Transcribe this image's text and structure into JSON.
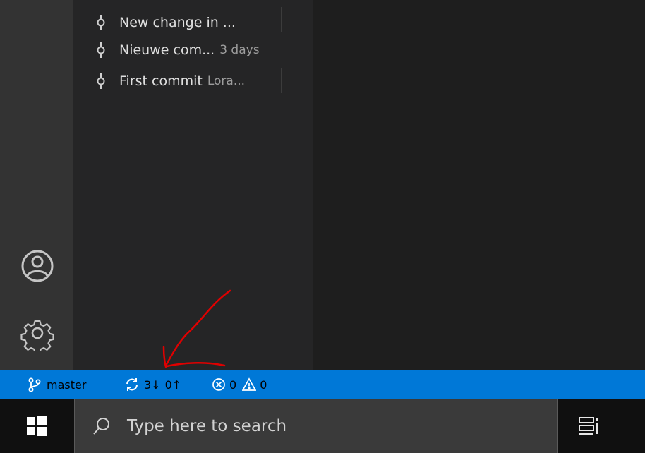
{
  "commits": [
    {
      "message": "New change in ...",
      "meta": ""
    },
    {
      "message": "Nieuwe com...",
      "meta": "3 days"
    },
    {
      "message": "First commit",
      "meta": "Lora..."
    }
  ],
  "activity_bar": {
    "icons": [
      "account-icon",
      "gear-icon"
    ]
  },
  "status_bar": {
    "branch": "master",
    "sync_incoming": "3↓",
    "sync_outgoing": "0↑",
    "errors": "0",
    "warnings": "0",
    "background": "#0078d7"
  },
  "taskbar": {
    "search_placeholder": "Type here to search",
    "icons": [
      "windows-logo-icon",
      "search-icon",
      "task-view-icon"
    ]
  },
  "annotation": {
    "color": "#e00000",
    "shape": "hand-drawn arrow pointing at sync indicator"
  }
}
